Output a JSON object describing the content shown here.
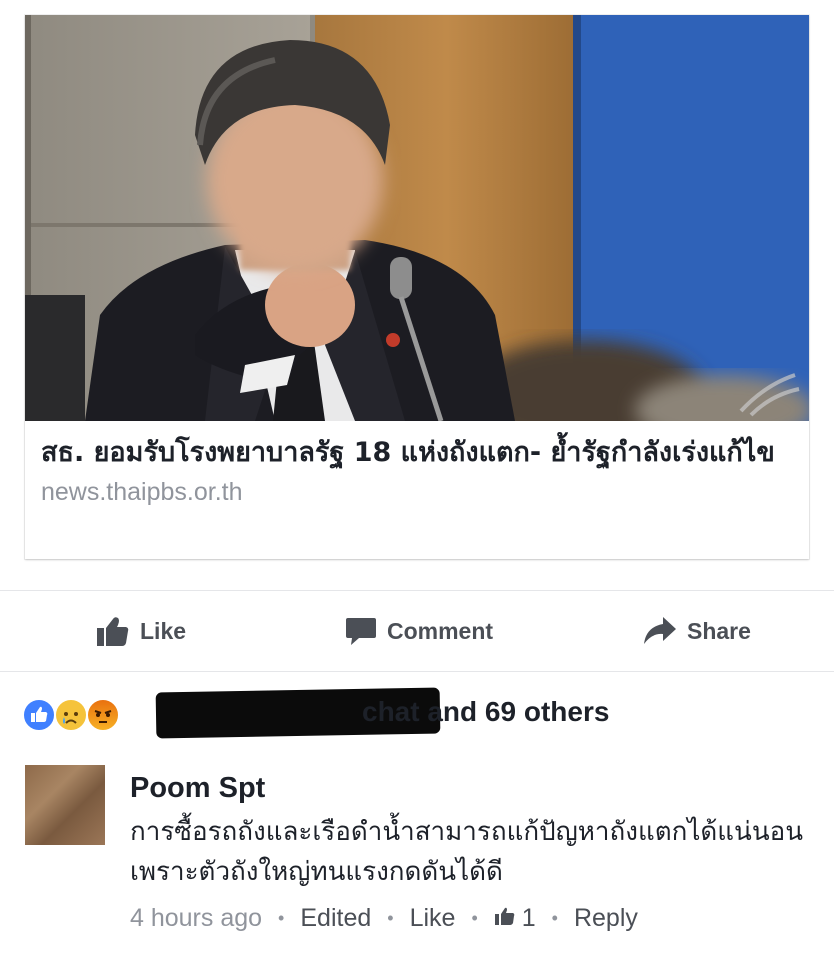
{
  "link_preview": {
    "headline": "สธ. ยอมรับโรงพยาบาลรัฐ 18 แห่งถังแตก- ย้ำรัฐกำลังเร่งแก้ไข",
    "domain": "news.thaipbs.or.th",
    "image_icon": "news-photo"
  },
  "actions": {
    "like_label": "Like",
    "comment_label": "Comment",
    "share_label": "Share"
  },
  "reactions": {
    "icons": [
      "like-icon",
      "sad-icon",
      "angry-icon"
    ],
    "summary_visible": "chat and 69 others"
  },
  "comment": {
    "author": "Poom Spt",
    "text": "การซื้อรถถังและเรือดำน้ำสามารถแก้ปัญหาถังแตกได้แน่นอน เพราะตัวถังใหญ่ทนแรงกดดันได้ดี",
    "time": "4 hours ago",
    "edited_label": "Edited",
    "like_label": "Like",
    "like_count": "1",
    "reply_label": "Reply"
  },
  "colors": {
    "text_primary": "#1d2129",
    "text_secondary": "#90949c",
    "action_gray": "#4b4f56",
    "like_blue": "#4080ff",
    "angry_red": "#e9710f"
  }
}
